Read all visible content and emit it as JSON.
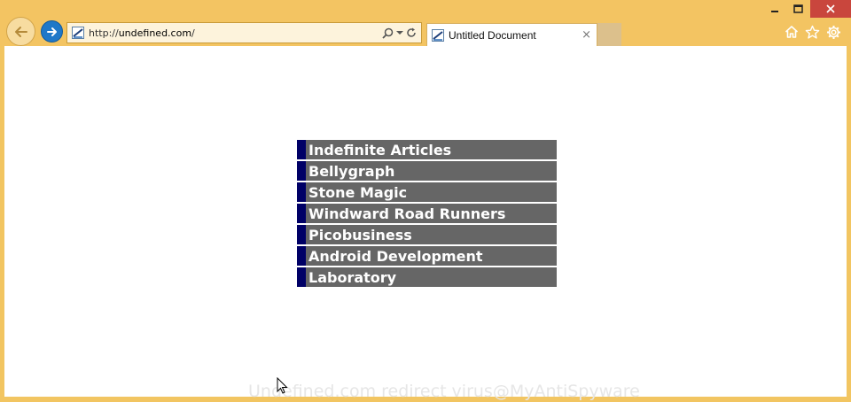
{
  "browser": {
    "address": {
      "prefix": "http://",
      "host": "undefined.com",
      "suffix": "/"
    },
    "tab": {
      "title": "Untitled Document",
      "close_glyph": "×"
    },
    "icons": [
      "back-arrow-icon",
      "forward-arrow-icon",
      "search-icon",
      "dropdown-icon",
      "refresh-icon",
      "home-icon",
      "star-icon",
      "gear-icon",
      "minimize-icon",
      "maximize-icon",
      "close-icon"
    ],
    "colors": {
      "frame": "#f3c462",
      "close_button": "#c9463d",
      "forward_button": "#1f78c8"
    }
  },
  "page": {
    "menu": {
      "items": [
        {
          "label": "Indefinite Articles"
        },
        {
          "label": "Bellygraph"
        },
        {
          "label": "Stone Magic"
        },
        {
          "label": "Windward Road Runners"
        },
        {
          "label": "Picobusiness"
        },
        {
          "label": "Android Development"
        },
        {
          "label": "Laboratory"
        }
      ],
      "colors": {
        "item_bg": "#666666",
        "item_accent": "#000066",
        "item_text": "#ffffff"
      }
    },
    "watermark": "Undefined.com redirect virus@MyAntiSpyware"
  }
}
